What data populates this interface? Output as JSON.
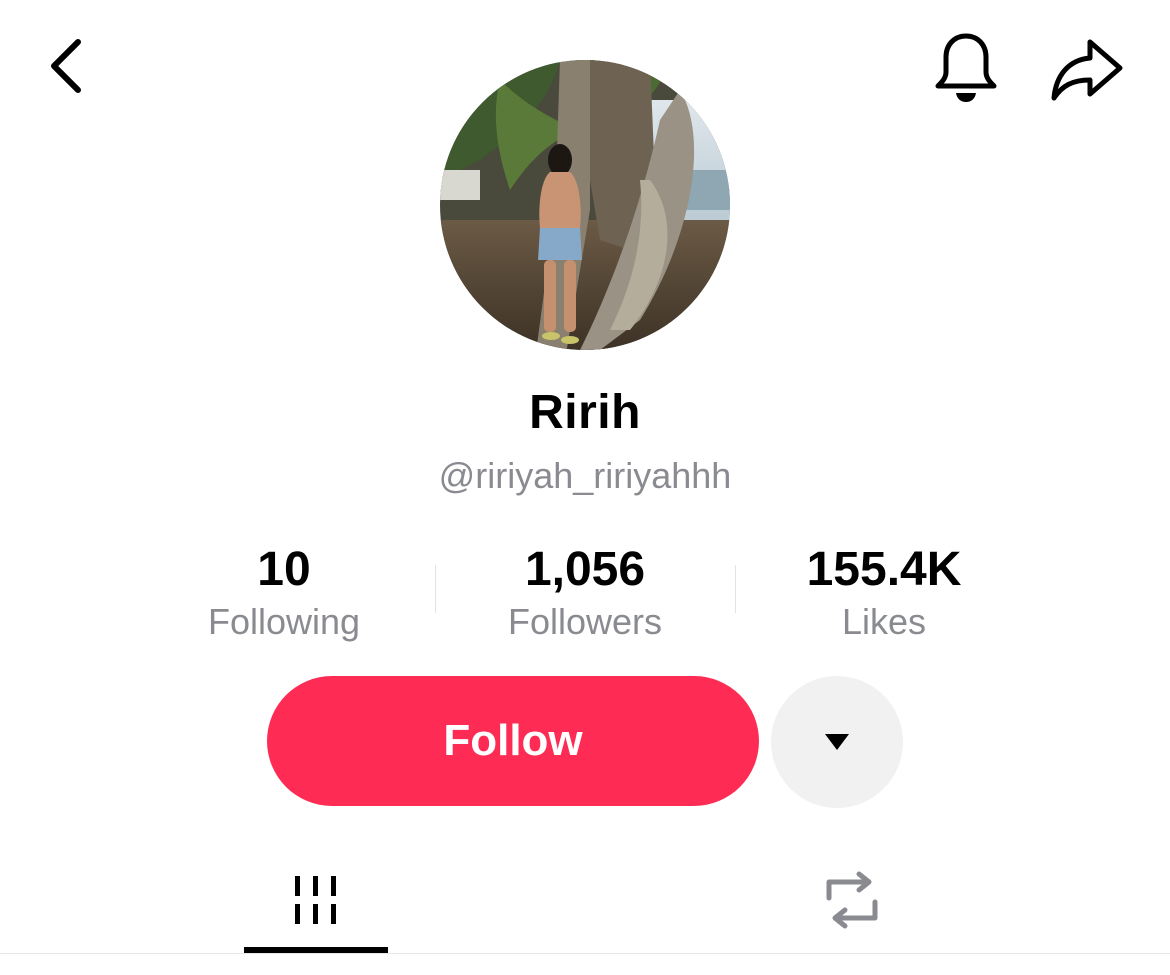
{
  "header": {
    "back_icon": "chevron-left-icon",
    "notification_icon": "bell-icon",
    "share_icon": "share-arrow-icon"
  },
  "profile": {
    "display_name": "Ririh",
    "username": "@ririyah_ririyahhh",
    "avatar_icon": "profile-photo"
  },
  "stats": {
    "following": {
      "value": "10",
      "label": "Following"
    },
    "followers": {
      "value": "1,056",
      "label": "Followers"
    },
    "likes": {
      "value": "155.4K",
      "label": "Likes"
    }
  },
  "actions": {
    "follow_label": "Follow",
    "more_icon": "caret-down-icon",
    "follow_color": "#fe2c55"
  },
  "tabs": [
    {
      "icon": "videos-grid-icon",
      "active": true
    },
    {
      "icon": "repost-icon",
      "active": false
    }
  ]
}
